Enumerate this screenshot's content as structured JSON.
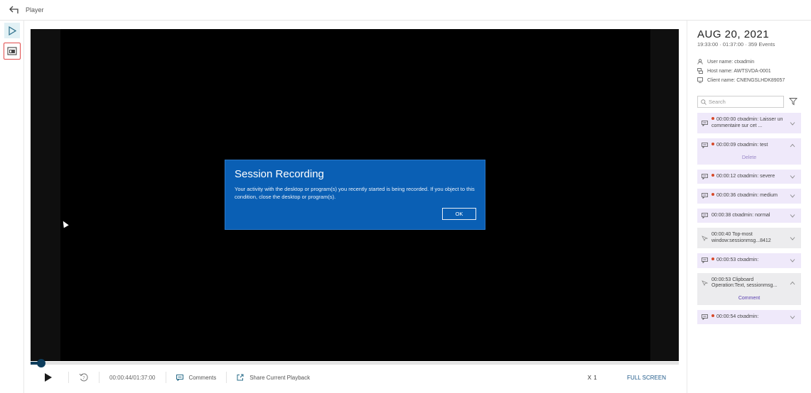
{
  "header": {
    "title": "Player"
  },
  "dialog": {
    "title": "Session Recording",
    "body": "Your activity with the desktop or program(s) you recently started is being recorded. If you object to this condition, close the desktop or program(s).",
    "ok_label": "OK"
  },
  "playback": {
    "progress": 0.008,
    "time": "00:00:44/01:37:00",
    "comments_label": "Comments",
    "share_label": "Share Current Playback",
    "speed": "X 1",
    "fullscreen_label": "FULL SCREEN"
  },
  "session": {
    "date": "AUG 20, 2021",
    "summary": "19:33:00 · 01:37:00 · 359 Events",
    "user": "User name: ctxadmin",
    "host": "Host name: AWTSVDA-0001",
    "client": "Client name: CNENGSLHDK89057"
  },
  "search": {
    "placeholder": "Search"
  },
  "events": [
    {
      "kind": "comment",
      "dot": true,
      "text": "00:00:00 ctxadmin: Laisser un commentaire sur cet ...",
      "expanded": false
    },
    {
      "kind": "comment",
      "dot": true,
      "text": "00:00:09 ctxadmin: test",
      "expanded": true,
      "action": "Delete"
    },
    {
      "kind": "comment",
      "dot": true,
      "text": "00:00:12 ctxadmin: severe",
      "expanded": false
    },
    {
      "kind": "comment",
      "dot": true,
      "text": "00:00:36 ctxadmin: medium",
      "expanded": false
    },
    {
      "kind": "comment",
      "dot": false,
      "text": "00:00:38 ctxadmin: normal",
      "expanded": false
    },
    {
      "kind": "window",
      "dot": false,
      "text": "00:00:40 Top-most window:sessionmsg...8412",
      "expanded": false
    },
    {
      "kind": "comment",
      "dot": true,
      "text": "00:00:53 ctxadmin:",
      "expanded": false
    },
    {
      "kind": "window",
      "dot": false,
      "text": "00:00:53 Clipboard Operation:Text, sessionmsg...",
      "expanded": true,
      "action": "Comment"
    },
    {
      "kind": "comment",
      "dot": true,
      "text": "00:00:54 ctxadmin:",
      "expanded": false
    }
  ],
  "colors": {
    "accent": "#0d3d5c",
    "dialog": "#0a5fb4",
    "event_bg": "#efe9fa",
    "dot": "#d64a2a",
    "highlight": "#e14b4b"
  },
  "icons": {
    "back": "arrow-left-icon",
    "play": "play-icon",
    "snapshot": "snapshot-icon",
    "replay": "replay-icon",
    "comment": "comment-icon",
    "share": "share-icon",
    "user": "user-icon",
    "host": "host-icon",
    "client": "monitor-icon",
    "search": "search-icon",
    "filter": "filter-icon",
    "chevron": "chevron-down-icon"
  }
}
